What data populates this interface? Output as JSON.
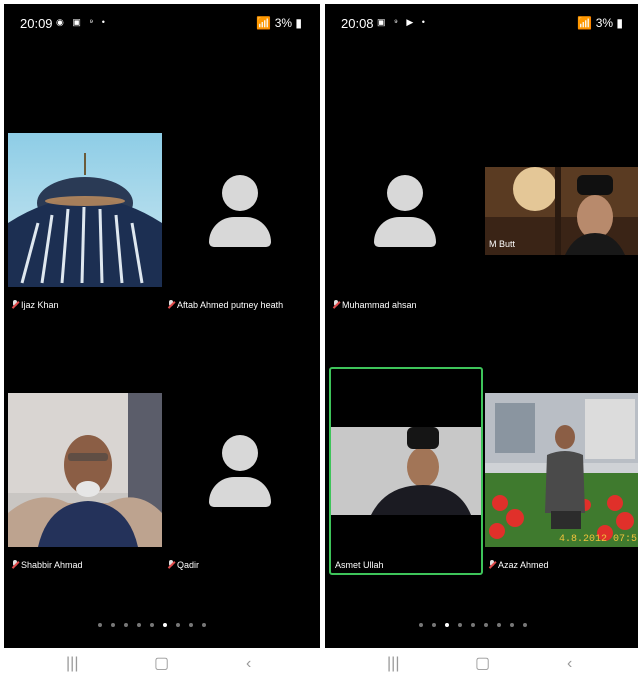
{
  "left_screen": {
    "status": {
      "time": "20:09",
      "battery": "3%"
    },
    "participants": [
      {
        "name": "Ijaz Khan"
      },
      {
        "name": "Aftab Ahmed putney heath"
      },
      {
        "name": "Shabbir Ahmad"
      },
      {
        "name": "Qadir"
      }
    ],
    "page_indicator": {
      "total": 9,
      "active": 5
    }
  },
  "right_screen": {
    "status": {
      "time": "20:08",
      "battery": "3%"
    },
    "participants": [
      {
        "name": "Muhammad ahsan"
      },
      {
        "name": "M Butt",
        "video_label": "M Butt"
      },
      {
        "name": "Asmet Ullah",
        "video_label": "Asmet Ullah"
      },
      {
        "name": "Azaz Ahmed"
      }
    ],
    "photo_timestamp": "4.8.2012 07:5",
    "page_indicator": {
      "total": 9,
      "active": 2
    }
  },
  "navbar": {
    "recents_icon": "recents-icon",
    "home_icon": "home-icon",
    "back_icon": "back-icon"
  },
  "colors": {
    "active_speaker": "#3ec45a",
    "muted_mic": "#e14c4c"
  }
}
